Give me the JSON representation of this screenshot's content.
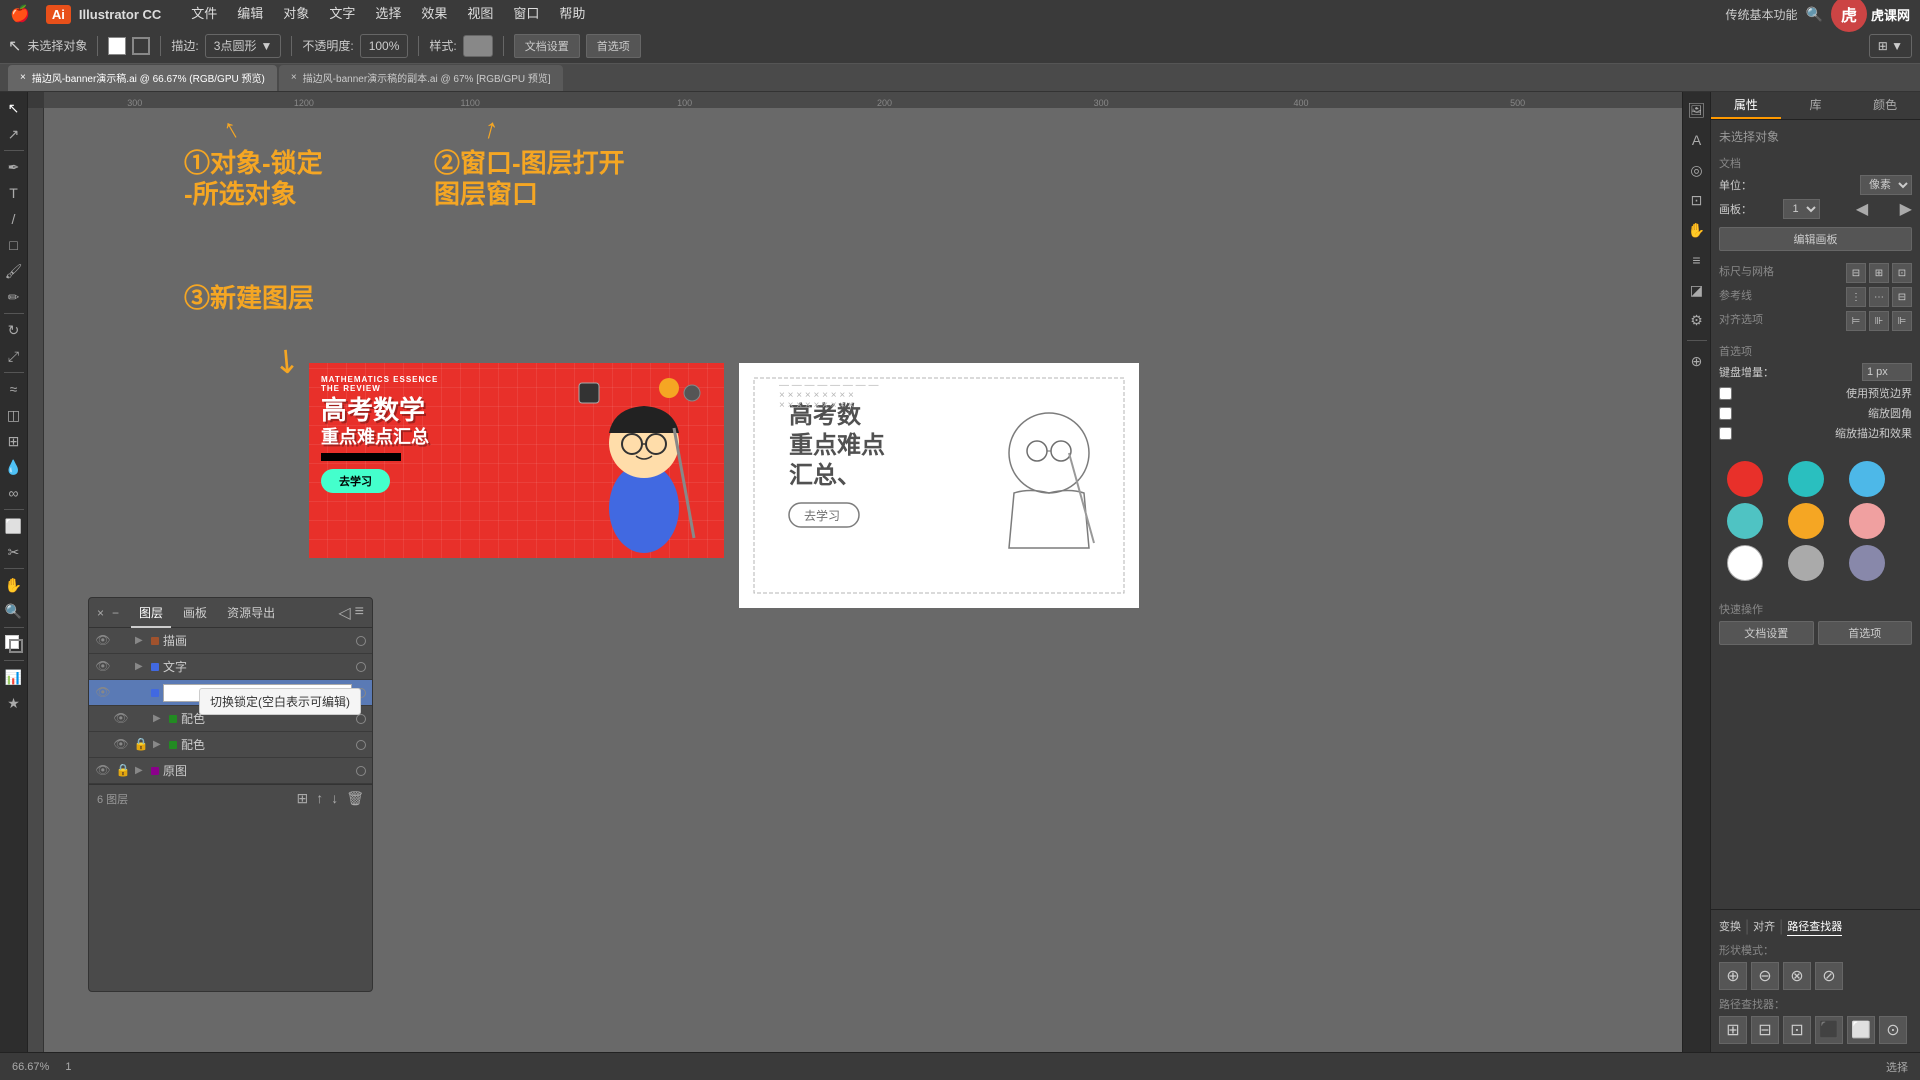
{
  "app": {
    "name": "Illustrator CC",
    "logo": "Ai"
  },
  "menubar": {
    "apple": "🍎",
    "items": [
      "文件",
      "编辑",
      "对象",
      "文字",
      "选择",
      "效果",
      "视图",
      "窗口",
      "帮助"
    ]
  },
  "toolbar": {
    "no_selection": "未选择对象",
    "stroke_label": "描边:",
    "stroke_value": "3点圆形",
    "opacity_label": "不透明度:",
    "opacity_value": "100%",
    "style_label": "样式:",
    "doc_settings": "文档设置",
    "preferences": "首选项"
  },
  "tabs": [
    {
      "label": "描边风-banner演示稿.ai @ 66.67% (RGB/GPU 预览)",
      "active": true
    },
    {
      "label": "描边风-banner演示稿的副本.ai @ 67% [RGB/GPU 预览]",
      "active": false
    }
  ],
  "annotations": {
    "step1": "①对象-锁定",
    "step1b": "-所选对象",
    "step2": "②窗口-图层打开",
    "step2b": "图层窗口",
    "step3": "③新建图层"
  },
  "right_panel": {
    "tabs": [
      "属性",
      "库",
      "颜色"
    ],
    "active_tab": "属性",
    "no_selection": "未选择对象",
    "doc_section": "文档",
    "unit_label": "单位：",
    "unit_value": "像素",
    "artboard_label": "画板：",
    "artboard_value": "1",
    "edit_artboard_btn": "编辑画板",
    "rulers_label": "标尺与网格",
    "guides_label": "参考线",
    "align_label": "对齐选项",
    "prefs_label": "首选项",
    "keyboard_label": "键盘增量：",
    "keyboard_value": "1 px",
    "snap_bounds": "使用预览边界",
    "scale_corners": "缩放圆角",
    "scale_strokes": "缩放描边和效果",
    "quick_actions": "快速操作",
    "doc_settings_btn": "文档设置",
    "preferences_btn": "首选项",
    "colors": [
      {
        "name": "red",
        "hex": "#e8302a"
      },
      {
        "name": "teal",
        "hex": "#2abfbf"
      },
      {
        "name": "blue",
        "hex": "#4db8e8"
      },
      {
        "name": "cyan",
        "hex": "#4fc3c3"
      },
      {
        "name": "orange",
        "hex": "#f5a623"
      },
      {
        "name": "pink",
        "hex": "#f0a0a0"
      },
      {
        "name": "white",
        "hex": "#ffffff"
      },
      {
        "name": "gray",
        "hex": "#aaaaaa"
      },
      {
        "name": "purple-gray",
        "hex": "#8888aa"
      }
    ]
  },
  "layers_panel": {
    "tabs": [
      "图层",
      "画板",
      "资源导出"
    ],
    "active_tab": "图层",
    "layers": [
      {
        "name": "描画",
        "visible": true,
        "locked": false,
        "color": "#a0522d",
        "indent": 0
      },
      {
        "name": "文字",
        "visible": true,
        "locked": false,
        "color": "#4169e1",
        "indent": 0
      },
      {
        "name": "",
        "visible": true,
        "locked": false,
        "color": "#4169e1",
        "indent": 0,
        "active": true,
        "editing": true
      },
      {
        "name": "配色",
        "visible": true,
        "locked": false,
        "color": "#228b22",
        "indent": 1
      },
      {
        "name": "配色",
        "visible": true,
        "locked": true,
        "color": "#228b22",
        "indent": 1
      },
      {
        "name": "原图",
        "visible": true,
        "locked": true,
        "color": "#8b008b",
        "indent": 0
      }
    ],
    "footer": "6 图层",
    "tooltip": "切换锁定(空白表示可编辑)"
  },
  "bottom_panel": {
    "tabs": [
      "变换",
      "对齐",
      "路径查找器"
    ],
    "active_tab": "路径查找器",
    "shape_modes_label": "形状模式：",
    "path_finder_label": "路径查找器："
  },
  "statusbar": {
    "zoom": "66.67%",
    "artboard": "1",
    "tool": "选择"
  },
  "banner_content": {
    "line1": "MATHEMATICS ESSENCE",
    "line2": "THE REVIEW",
    "main_text": "高考数学",
    "sub_text": "重点难点汇总",
    "black_bar": "■■■■■■",
    "button": "去学习"
  }
}
